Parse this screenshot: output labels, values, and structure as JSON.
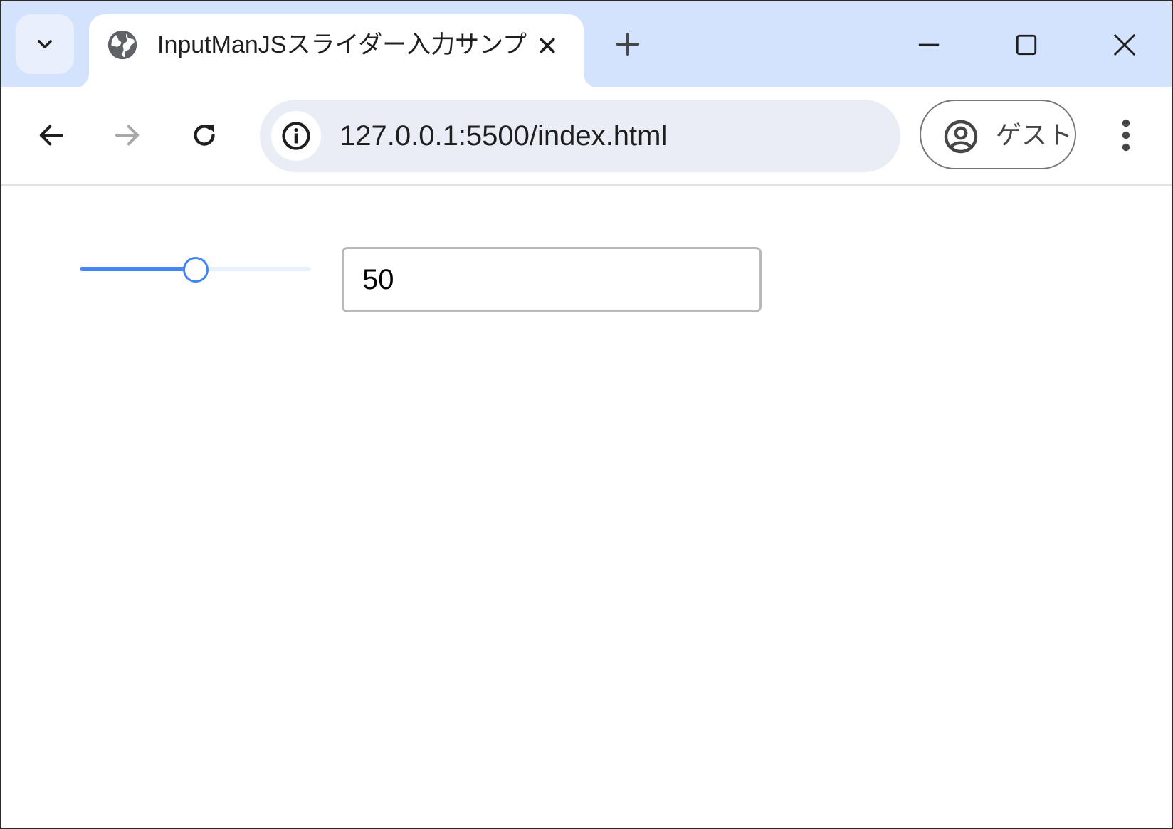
{
  "browser": {
    "tab": {
      "title": "InputManJSスライダー入力サンプル",
      "favicon": "globe-icon"
    },
    "address_bar": {
      "url": "127.0.0.1:5500/index.html"
    },
    "profile": {
      "label": "ゲスト"
    },
    "colors": {
      "tabstrip": "#d3e3fd",
      "omnibox": "#e9eef6",
      "accent": "#4285f4"
    }
  },
  "page": {
    "slider": {
      "value": 50,
      "min": 0,
      "max": 100
    },
    "number_input": {
      "value": "50"
    }
  }
}
